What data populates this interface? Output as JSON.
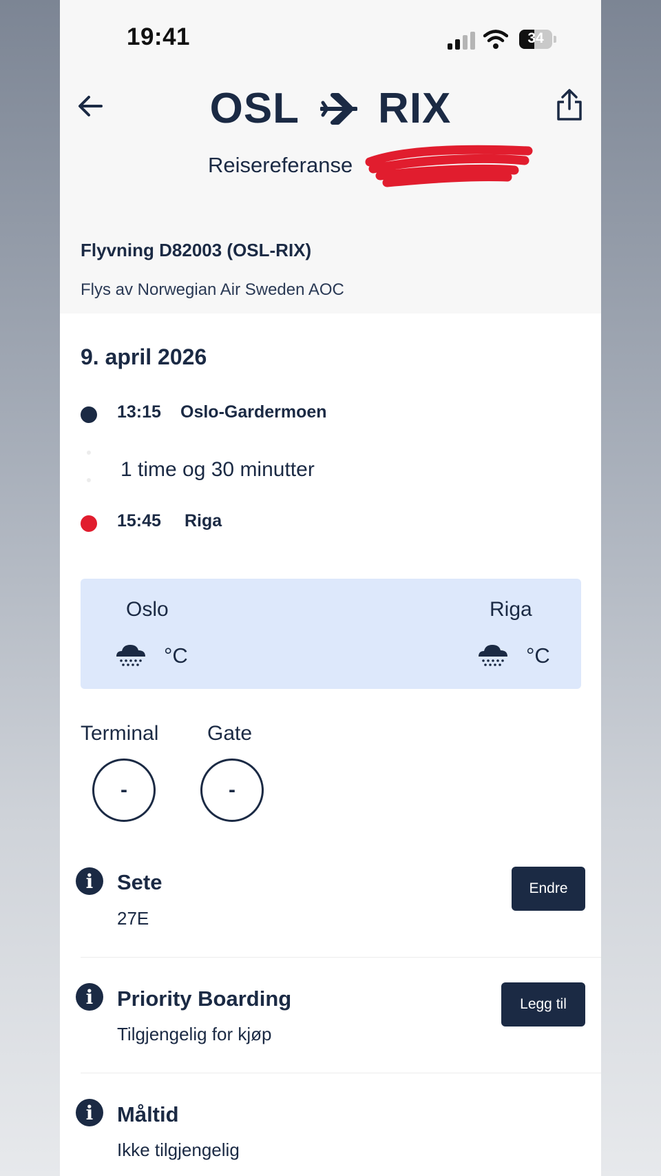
{
  "status_bar": {
    "time": "19:41",
    "battery": "34"
  },
  "header": {
    "origin": "OSL",
    "destination": "RIX",
    "reference_label": "Reisereferanse"
  },
  "flight": {
    "title": "Flyvning D82003 (OSL-RIX)",
    "operator": "Flys av Norwegian Air Sweden AOC"
  },
  "itinerary": {
    "date": "9. april 2026",
    "departure": {
      "time": "13:15",
      "place": "Oslo-Gardermoen"
    },
    "duration": "1 time og 30 minutter",
    "arrival": {
      "time": "15:45",
      "place": "Riga"
    }
  },
  "weather": {
    "origin": {
      "city": "Oslo",
      "unit": "°C",
      "icon": "rain-cloud-icon"
    },
    "destination": {
      "city": "Riga",
      "unit": "°C",
      "icon": "rain-cloud-icon"
    }
  },
  "terminal": {
    "label": "Terminal",
    "value": "-"
  },
  "gate": {
    "label": "Gate",
    "value": "-"
  },
  "services": [
    {
      "title": "Sete",
      "subtitle": "27E",
      "button": "Endre"
    },
    {
      "title": "Priority Boarding",
      "subtitle": "Tilgjengelig for kjøp",
      "button": "Legg til"
    },
    {
      "title": "Måltid",
      "subtitle": "Ikke tilgjengelig"
    }
  ],
  "colors": {
    "navy": "#1b2a44",
    "arrival_red": "#e11d2e",
    "weather_bg": "#dde8fb",
    "header_bg": "#f7f7f7"
  }
}
